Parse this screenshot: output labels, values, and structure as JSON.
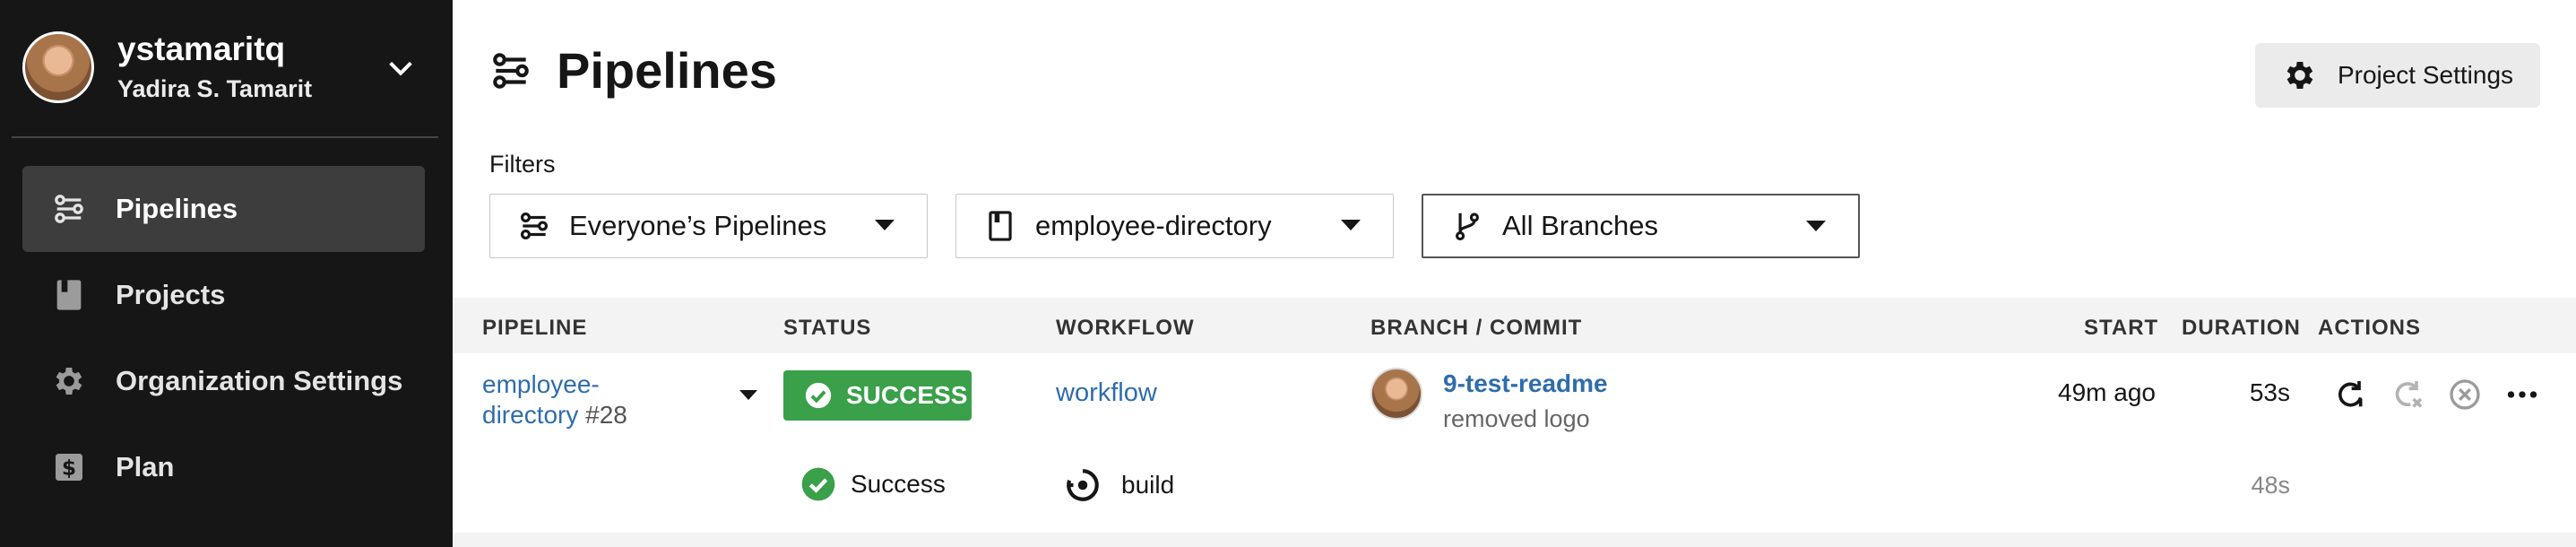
{
  "user": {
    "login": "ystamaritq",
    "full_name": "Yadira S. Tamarit"
  },
  "sidebar": {
    "items": [
      {
        "label": "Pipelines",
        "icon": "pipelines-icon",
        "active": true
      },
      {
        "label": "Projects",
        "icon": "book-icon",
        "active": false
      },
      {
        "label": "Organization Settings",
        "icon": "gear-icon",
        "active": false
      },
      {
        "label": "Plan",
        "icon": "dollar-icon",
        "active": false
      }
    ]
  },
  "header": {
    "title": "Pipelines",
    "project_settings_label": "Project Settings"
  },
  "filters": {
    "label": "Filters",
    "pipelines": "Everyone’s Pipelines",
    "project": "employee-directory",
    "branch": "All Branches"
  },
  "table": {
    "columns": {
      "pipeline": "PIPELINE",
      "status": "STATUS",
      "workflow": "WORKFLOW",
      "branch_commit": "BRANCH / COMMIT",
      "start": "START",
      "duration": "DURATION",
      "actions": "ACTIONS"
    },
    "rows": [
      {
        "pipeline_name": "employee-directory",
        "pipeline_number": "#28",
        "status": "SUCCESS",
        "workflow": "workflow",
        "branch": "9-test-readme",
        "commit_message": "removed logo",
        "start": "49m ago",
        "duration": "53s",
        "jobs": [
          {
            "status": "Success",
            "name": "build",
            "duration": "48s"
          }
        ]
      }
    ]
  },
  "colors": {
    "sidebar_bg": "#161616",
    "sidebar_active": "#3d3d3d",
    "success": "#3aa04a",
    "link": "#2f6dab"
  }
}
